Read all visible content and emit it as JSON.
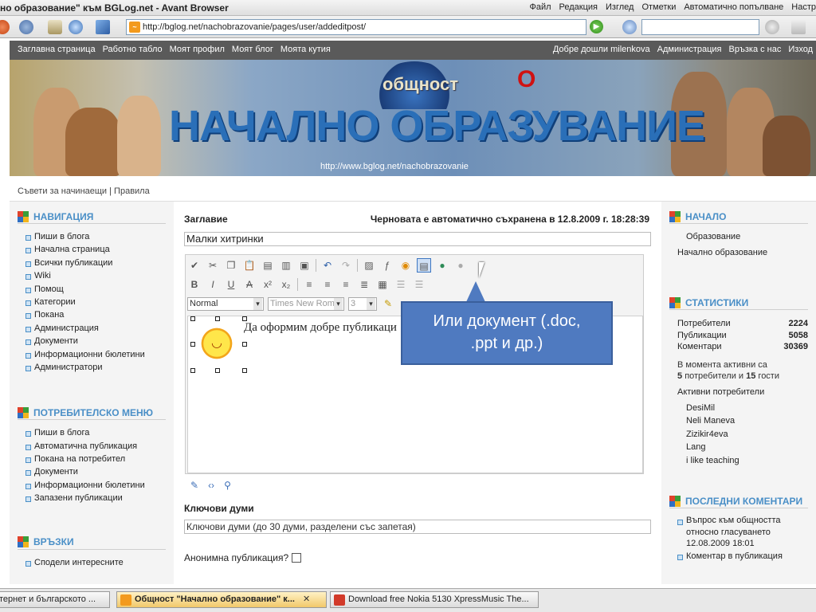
{
  "browser": {
    "window_title": "но образование\" към BGLog.net - Avant Browser",
    "menu": [
      "Файл",
      "Редакция",
      "Изглед",
      "Отметки",
      "Автоматично попълване",
      "Настр"
    ],
    "url": "http://bglog.net/nachobrazovanie/pages/user/addeditpost/"
  },
  "site_nav": {
    "left": [
      "Заглавна страница",
      "Работно табло",
      "Моят профил",
      "Моят блог",
      "Моята кутия"
    ],
    "right": [
      "Добре дошли milenkova",
      "Администрация",
      "Връзка с нас",
      "Изход"
    ]
  },
  "banner": {
    "subtitle": "общност",
    "title": "НАЧАЛНО ОБРАЗУВАНИЕ",
    "correction_letter": "О",
    "url": "http://www.bglog.net/nachobrazovanie"
  },
  "subbar": {
    "links": "Съвети за начинаещи | Правила"
  },
  "left": {
    "navigation": {
      "title": "НАВИГАЦИЯ",
      "items": [
        "Пиши в блога",
        "Начална страница",
        "Всички публикации",
        "Wiki",
        "Помощ",
        "Категории",
        "Покана",
        "Администрация",
        "Документи",
        "Информационни бюлетини",
        "Администратори"
      ]
    },
    "user_menu": {
      "title": "ПОТРЕБИТЕЛСКО МЕНЮ",
      "items": [
        "Пиши в блога",
        "Автоматична публикация",
        "Покана на потребител",
        "Документи",
        "Информационни бюлетини",
        "Запазени публикации"
      ]
    },
    "links": {
      "title": "ВРЪЗКИ",
      "items": [
        "Сподели интересните"
      ]
    }
  },
  "form": {
    "title_label": "Заглавие",
    "autosave": "Черновата е автоматично съхранена в 12.8.2009 г. 18:28:39",
    "title_value": "Малки хитринки",
    "format_select": "Normal",
    "font_select": "Times New Roma",
    "size_select": "3",
    "body_text": "Да оформим добре публикаци",
    "keywords_label": "Ключови думи",
    "keywords_placeholder": "Ключови думи (до 30 думи, разделени със запетая)",
    "anonymous_label": "Анонимна публикация?"
  },
  "callout": {
    "line1": "Или документ (.doc,",
    "line2": ".ppt и др.)"
  },
  "right": {
    "home": {
      "title": "НАЧАЛО",
      "items": [
        "Образование",
        "Начално образование"
      ]
    },
    "stats": {
      "title": "СТАТИСТИКИ",
      "rows": [
        {
          "label": "Потребители",
          "value": "2224"
        },
        {
          "label": "Публикации",
          "value": "5058"
        },
        {
          "label": "Коментари",
          "value": "30369"
        }
      ],
      "online_line1": "В момента активни са",
      "online_users": "5",
      "online_mid": "потребители и",
      "online_guests": "15",
      "online_end": "гости",
      "active_title": "Активни потребители",
      "active_users": [
        "DesiMil",
        "Neli Maneva",
        "Zizikir4eva",
        "Lang",
        "i like teaching"
      ]
    },
    "comments": {
      "title": "ПОСЛЕДНИ КОМЕНТАРИ",
      "item_line1": "Въпрос към общността",
      "item_line2": "относно гласуването",
      "item_date": "12.08.2009 18:01",
      "item2": "Коментар в публикация"
    }
  },
  "taskbar": {
    "tasks": [
      "тернет и българското ...",
      "Общност \"Начално образование\" к...",
      "Download free Nokia 5130 XpressMusic The..."
    ]
  },
  "colors": {
    "accent": "#4a8fc7",
    "callout": "#4f7ac0",
    "nav_bar": "#5a5a5a"
  }
}
